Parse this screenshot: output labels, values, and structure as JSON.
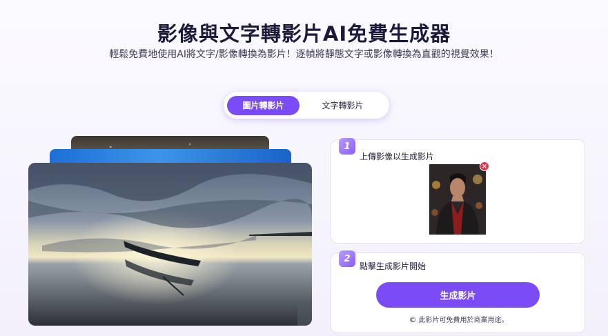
{
  "header": {
    "title": "影像與文字轉影片AI免費生成器",
    "subtitle": "輕鬆免費地使用AI將文字/影像轉換為影片！逐幀將靜態文字或影像轉換為直觀的視覺效果！"
  },
  "tabs": [
    {
      "label": "圖片轉影片",
      "active": true
    },
    {
      "label": "文字轉影片",
      "active": false
    }
  ],
  "steps": [
    {
      "number": "1",
      "label": "上傳影像以生成影片"
    },
    {
      "number": "2",
      "label": "點擊生成影片開始"
    }
  ],
  "upload": {
    "remove_icon": "close-icon",
    "remove_glyph": "×"
  },
  "generate_button": {
    "label": "生成影片"
  },
  "note": {
    "icon": "copyright-icon",
    "glyph": "©",
    "text": "此影片可免費用於商業用途。"
  },
  "colors": {
    "accent": "#7b4cf5",
    "remove": "#e5334b"
  }
}
